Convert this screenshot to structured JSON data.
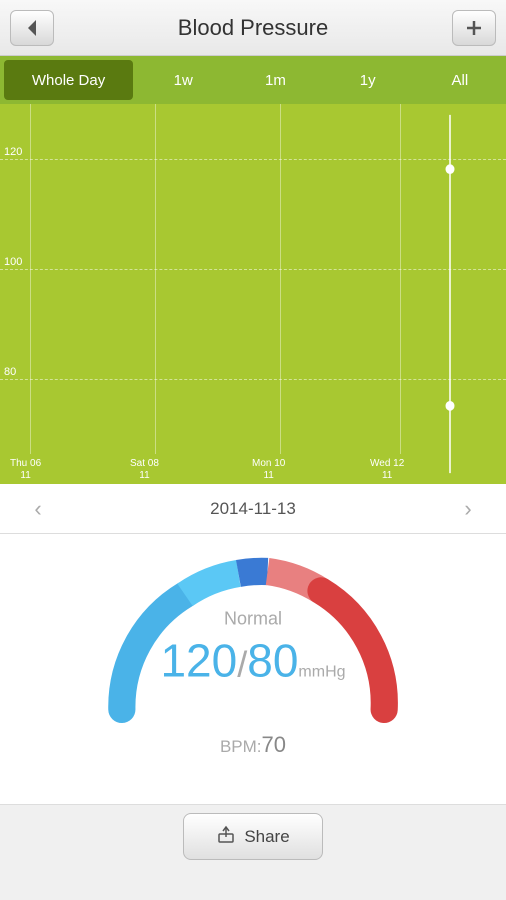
{
  "header": {
    "title": "Blood Pressure",
    "back_label": "◀",
    "menu_label": "≡",
    "add_label": "+"
  },
  "tabs": [
    {
      "id": "whole-day",
      "label": "Whole Day",
      "active": true
    },
    {
      "id": "1w",
      "label": "1w",
      "active": false
    },
    {
      "id": "1m",
      "label": "1m",
      "active": false
    },
    {
      "id": "1y",
      "label": "1y",
      "active": false
    },
    {
      "id": "all",
      "label": "All",
      "active": false
    }
  ],
  "chart": {
    "grid_lines": [
      120,
      100,
      80
    ],
    "x_labels": [
      {
        "text": "Thu 06",
        "sub": "11",
        "x_pct": 6
      },
      {
        "text": "Sat 08",
        "sub": "11",
        "x_pct": 25
      },
      {
        "text": "Mon 10",
        "sub": "11",
        "x_pct": 46
      },
      {
        "text": "Wed 12",
        "sub": "11",
        "x_pct": 68
      }
    ]
  },
  "date_nav": {
    "date": "2014-11-13",
    "prev_label": "‹",
    "next_label": "›"
  },
  "gauge": {
    "status": "Normal",
    "systolic": "120",
    "separator": "/",
    "diastolic": "80",
    "unit": "mmHg",
    "bpm_label": "BPM:",
    "bpm_value": "70"
  },
  "share_bar": {
    "button_label": "Share"
  },
  "colors": {
    "chart_bg": "#a8c831",
    "tab_active": "#5a7a10",
    "tab_bg": "#8db832"
  }
}
